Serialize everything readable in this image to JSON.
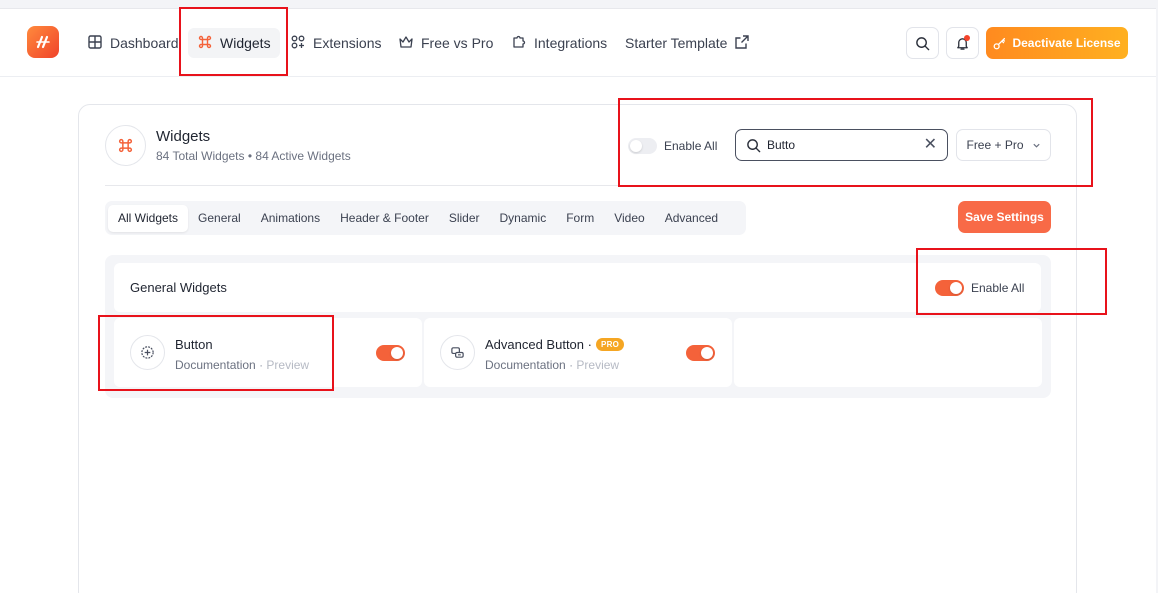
{
  "nav": {
    "items": [
      {
        "label": "Dashboard",
        "icon": "dashboard-grid-icon"
      },
      {
        "label": "Widgets",
        "icon": "command-icon",
        "active": true
      },
      {
        "label": "Extensions",
        "icon": "extensions-icon"
      },
      {
        "label": "Free vs Pro",
        "icon": "crown-icon"
      },
      {
        "label": "Integrations",
        "icon": "puzzle-icon"
      },
      {
        "label": "Starter Template",
        "icon": "external-link-icon"
      }
    ],
    "deactivate_label": "Deactivate License"
  },
  "widgets_panel": {
    "title": "Widgets",
    "total_text": "84 Total Widgets",
    "bullet": "•",
    "active_text": "84 Active Widgets",
    "enable_all_label": "Enable All",
    "enable_all_on": false,
    "search": {
      "value": "Butto",
      "clear_glyph": "✕"
    },
    "plan_filter": {
      "selected": "Free + Pro"
    },
    "tabs": [
      "All Widgets",
      "General",
      "Animations",
      "Header & Footer",
      "Slider",
      "Dynamic",
      "Form",
      "Video",
      "Advanced"
    ],
    "active_tab": "All Widgets",
    "save_label": "Save Settings"
  },
  "group": {
    "title": "General Widgets",
    "enable_all_label": "Enable All",
    "enable_all_on": true,
    "widgets": [
      {
        "name": "Button",
        "doc": "Documentation",
        "sep": "·",
        "preview": "Preview",
        "enabled": true,
        "pro": false,
        "icon": "plus-circle-icon"
      },
      {
        "name": "Advanced Button ·",
        "badge": "PRO",
        "doc": "Documentation",
        "sep": "·",
        "preview": "Preview",
        "enabled": true,
        "pro": true,
        "icon": "advanced-button-icon"
      }
    ]
  },
  "colors": {
    "accent": "#f4623a",
    "toggle_on": "#f4623a",
    "deactivate_gradient_start": "#ff8a1f",
    "deactivate_gradient_end": "#ffb020",
    "save_button": "#f86a47",
    "pro_badge": "#f5a623",
    "highlight_box": "#e8121b"
  }
}
